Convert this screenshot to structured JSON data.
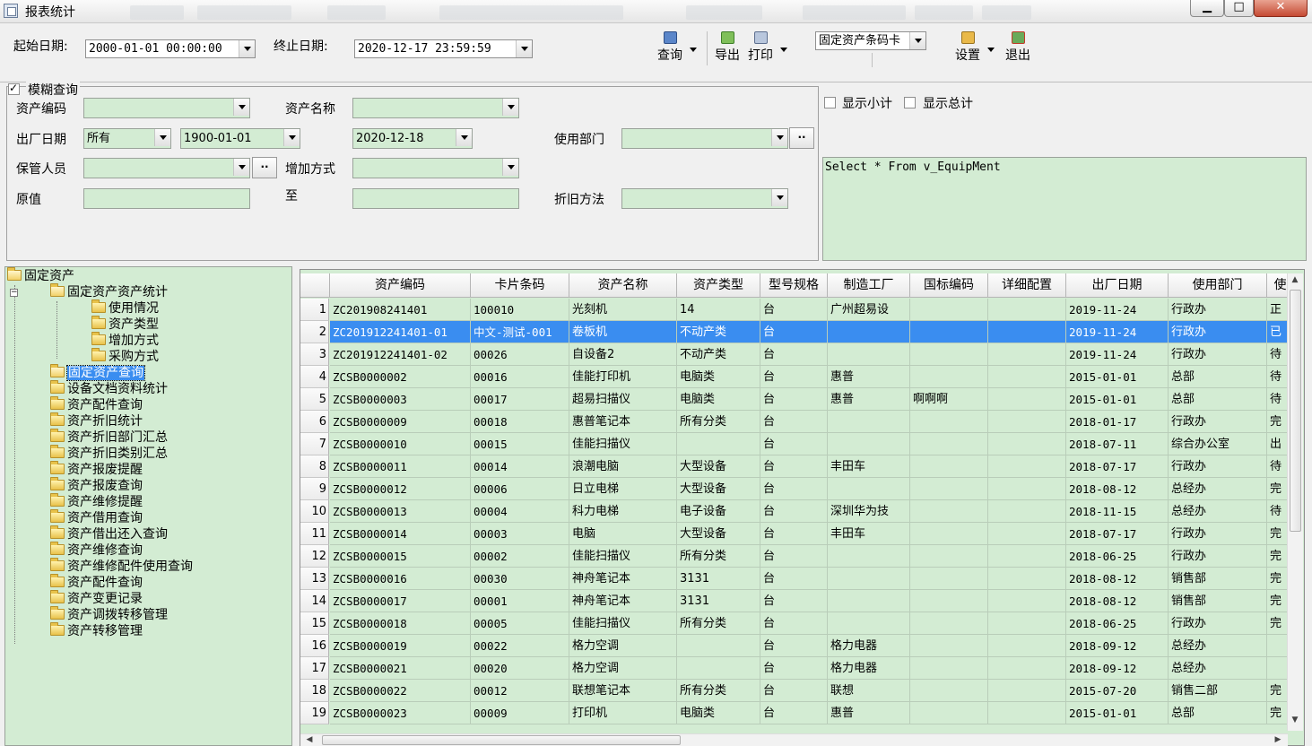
{
  "window": {
    "title": "报表统计",
    "min": "▁",
    "max": "□",
    "close": "✕"
  },
  "toolbar": {
    "start_label": "起始日期:",
    "start_value": "2000-01-01 00:00:00",
    "end_label": "终止日期:",
    "end_value": "2020-12-17 23:59:59",
    "query": "查询",
    "export": "导出",
    "print": "打印",
    "report_select": "固定资产条码卡",
    "settings": "设置",
    "exit": "退出"
  },
  "filter": {
    "fuzzy": "模糊查询",
    "asset_code": "资产编码",
    "asset_name": "资产名称",
    "factory_date": "出厂日期",
    "factory_mode": "所有",
    "date_from": "1900-01-01",
    "date_to": "2020-12-18",
    "dept": "使用部门",
    "keeper": "保管人员",
    "add_method": "增加方式",
    "to": "至",
    "original_value": "原值",
    "depr_method": "折旧方法",
    "dots": "··"
  },
  "options": {
    "show_subtotal": "显示小计",
    "show_total": "显示总计",
    "sql": "Select * From v_EquipMent"
  },
  "tree": {
    "root": "固定资产",
    "stat": "固定资产资产统计",
    "sub": [
      "使用情况",
      "资产类型",
      "增加方式",
      "采购方式"
    ],
    "selected": "固定资产查询",
    "items": [
      "设备文档资料统计",
      "资产配件查询",
      "资产折旧统计",
      "资产折旧部门汇总",
      "资产折旧类别汇总",
      "资产报废提醒",
      "资产报废查询",
      "资产维修提醒",
      "资产借用查询",
      "资产借出还入查询",
      "资产维修查询",
      "资产维修配件使用查询",
      "资产配件查询",
      "资产变更记录",
      "资产调拨转移管理",
      "资产转移管理"
    ]
  },
  "grid": {
    "columns": [
      "资产编码",
      "卡片条码",
      "资产名称",
      "资产类型",
      "型号规格",
      "制造工厂",
      "国标编码",
      "详细配置",
      "出厂日期",
      "使用部门",
      "使"
    ],
    "rows": [
      [
        "1",
        "ZC201908241401",
        "100010",
        "光刻机",
        "14",
        "台",
        "广州超易设",
        "",
        "",
        "2019-11-24",
        "行政办",
        "正"
      ],
      [
        "2",
        "ZC201912241401-01",
        "中文-测试-001",
        "卷板机",
        "不动产类",
        "台",
        "",
        "",
        "",
        "2019-11-24",
        "行政办",
        "已"
      ],
      [
        "3",
        "ZC201912241401-02",
        "00026",
        "自设备2",
        "不动产类",
        "台",
        "",
        "",
        "",
        "2019-11-24",
        "行政办",
        "待"
      ],
      [
        "4",
        "ZCSB0000002",
        "00016",
        "佳能打印机",
        "电脑类",
        "台",
        "惠普",
        "",
        "",
        "2015-01-01",
        "总部",
        "待"
      ],
      [
        "5",
        "ZCSB0000003",
        "00017",
        "超易扫描仪",
        "电脑类",
        "台",
        "惠普",
        "啊啊啊",
        "",
        "2015-01-01",
        "总部",
        "待"
      ],
      [
        "6",
        "ZCSB0000009",
        "00018",
        "惠普笔记本",
        "所有分类",
        "台",
        "",
        "",
        "",
        "2018-01-17",
        "行政办",
        "完"
      ],
      [
        "7",
        "ZCSB0000010",
        "00015",
        "佳能扫描仪",
        "",
        "台",
        "",
        "",
        "",
        "2018-07-11",
        "综合办公室",
        "出"
      ],
      [
        "8",
        "ZCSB0000011",
        "00014",
        "浪潮电脑",
        "大型设备",
        "台",
        "丰田车",
        "",
        "",
        "2018-07-17",
        "行政办",
        "待"
      ],
      [
        "9",
        "ZCSB0000012",
        "00006",
        "日立电梯",
        "大型设备",
        "台",
        "",
        "",
        "",
        "2018-08-12",
        "总经办",
        "完"
      ],
      [
        "10",
        "ZCSB0000013",
        "00004",
        "科力电梯",
        "电子设备",
        "台",
        "深圳华为技",
        "",
        "",
        "2018-11-15",
        "总经办",
        "待"
      ],
      [
        "11",
        "ZCSB0000014",
        "00003",
        "电脑",
        "大型设备",
        "台",
        "丰田车",
        "",
        "",
        "2018-07-17",
        "行政办",
        "完"
      ],
      [
        "12",
        "ZCSB0000015",
        "00002",
        "佳能扫描仪",
        "所有分类",
        "台",
        "",
        "",
        "",
        "2018-06-25",
        "行政办",
        "完"
      ],
      [
        "13",
        "ZCSB0000016",
        "00030",
        "神舟笔记本",
        "3131",
        "台",
        "",
        "",
        "",
        "2018-08-12",
        "销售部",
        "完"
      ],
      [
        "14",
        "ZCSB0000017",
        "00001",
        "神舟笔记本",
        "3131",
        "台",
        "",
        "",
        "",
        "2018-08-12",
        "销售部",
        "完"
      ],
      [
        "15",
        "ZCSB0000018",
        "00005",
        "佳能扫描仪",
        "所有分类",
        "台",
        "",
        "",
        "",
        "2018-06-25",
        "行政办",
        "完"
      ],
      [
        "16",
        "ZCSB0000019",
        "00022",
        "格力空调",
        "",
        "台",
        "格力电器",
        "",
        "",
        "2018-09-12",
        "总经办",
        ""
      ],
      [
        "17",
        "ZCSB0000021",
        "00020",
        "格力空调",
        "",
        "台",
        "格力电器",
        "",
        "",
        "2018-09-12",
        "总经办",
        ""
      ],
      [
        "18",
        "ZCSB0000022",
        "00012",
        "联想笔记本",
        "所有分类",
        "台",
        "联想",
        "",
        "",
        "2015-07-20",
        "销售二部",
        "完"
      ],
      [
        "19",
        "ZCSB0000023",
        "00009",
        "打印机",
        "电脑类",
        "台",
        "惠普",
        "",
        "",
        "2015-01-01",
        "总部",
        "完"
      ]
    ]
  },
  "colors": {
    "grid_bg": "#d3ecd3",
    "selection": "#3a8df0"
  }
}
